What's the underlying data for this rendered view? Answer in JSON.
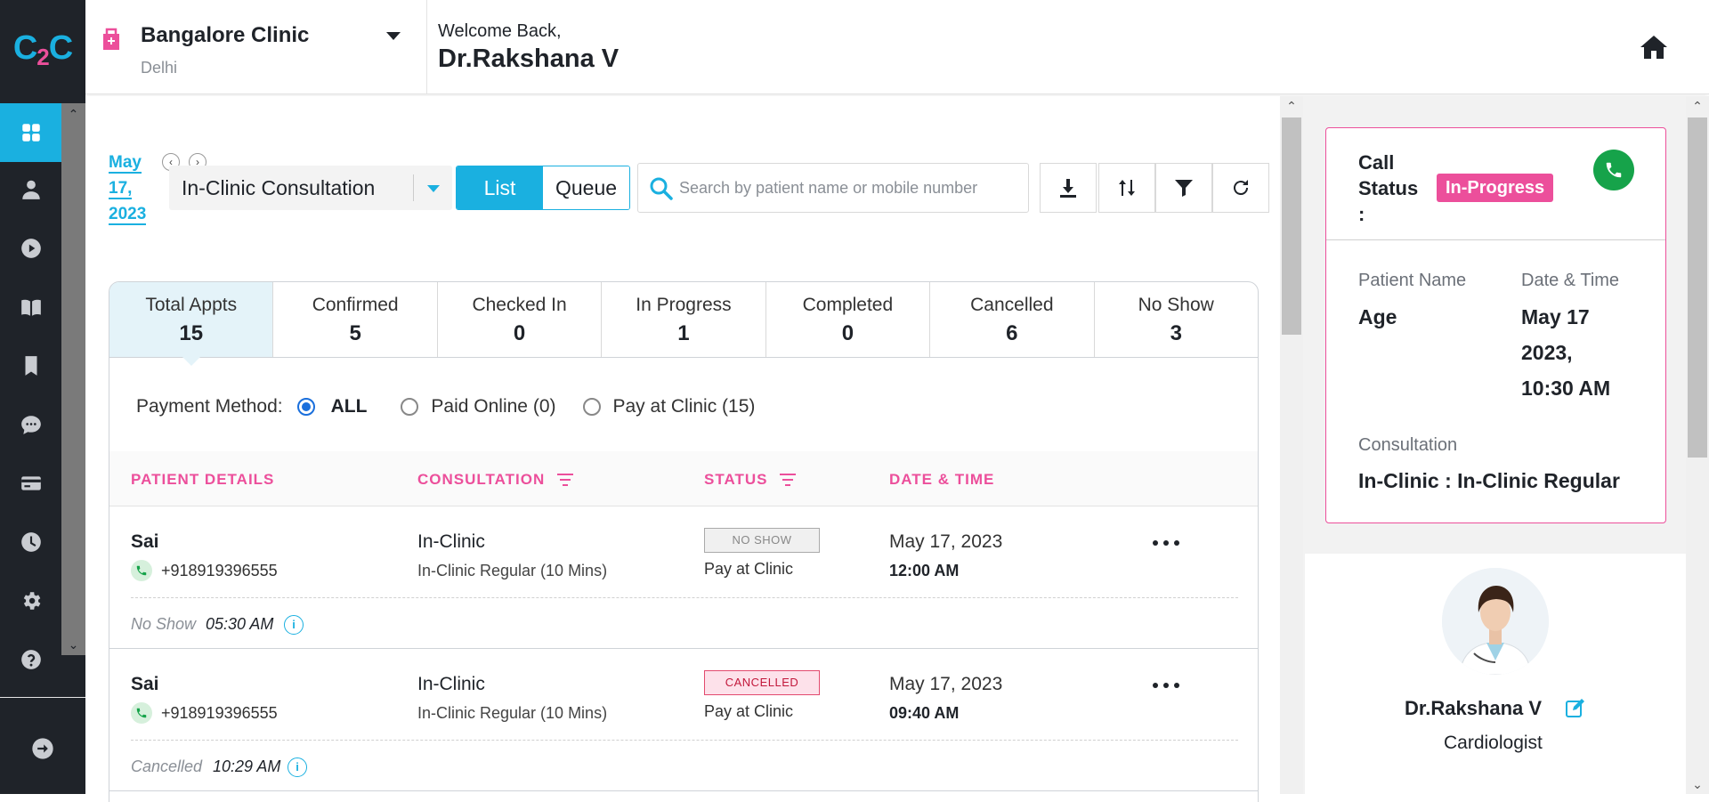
{
  "sidebar": {
    "logo": {
      "c1": "C",
      "two": "2",
      "c2": "C"
    },
    "items": [
      {
        "name": "dashboard-icon",
        "active": true
      },
      {
        "name": "user-icon"
      },
      {
        "name": "play-icon"
      },
      {
        "name": "book-icon"
      },
      {
        "name": "bookmark-icon"
      },
      {
        "name": "chat-icon"
      },
      {
        "name": "card-icon"
      },
      {
        "name": "clock-icon"
      },
      {
        "name": "gear-icon"
      },
      {
        "name": "help-icon"
      }
    ],
    "logout_icon": "logout-icon"
  },
  "header": {
    "clinic_name": "Bangalore Clinic",
    "clinic_city": "Delhi",
    "welcome": "Welcome Back,",
    "doctor_name": "Dr.Rakshana V"
  },
  "toolbar": {
    "date_line1": "May",
    "date_line2": "17,",
    "date_line3": "2023",
    "consultation_type": "In-Clinic Consultation",
    "view_list": "List",
    "view_queue": "Queue",
    "search_placeholder": "Search by patient name or mobile number"
  },
  "stats": [
    {
      "label": "Total Appts",
      "value": "15",
      "active": true
    },
    {
      "label": "Confirmed",
      "value": "5"
    },
    {
      "label": "Checked In",
      "value": "0"
    },
    {
      "label": "In Progress",
      "value": "1"
    },
    {
      "label": "Completed",
      "value": "0"
    },
    {
      "label": "Cancelled",
      "value": "6"
    },
    {
      "label": "No Show",
      "value": "3"
    }
  ],
  "payment": {
    "label": "Payment Method:",
    "options": [
      {
        "label": "ALL",
        "checked": true
      },
      {
        "label": "Paid Online (0)"
      },
      {
        "label": "Pay at Clinic (15)"
      }
    ]
  },
  "table": {
    "headers": {
      "patient": "PATIENT DETAILS",
      "consultation": "CONSULTATION",
      "status": "STATUS",
      "datetime": "DATE & TIME"
    },
    "rows": [
      {
        "name": "Sai",
        "phone": "+918919396555",
        "consult_type": "In-Clinic",
        "consult_desc": "In-Clinic Regular (10 Mins)",
        "status": "NO SHOW",
        "payment": "Pay at Clinic",
        "date": "May 17, 2023",
        "time": "12:00 AM",
        "note_label": "No Show",
        "note_time": "05:30 AM"
      },
      {
        "name": "Sai",
        "phone": "+918919396555",
        "consult_type": "In-Clinic",
        "consult_desc": "In-Clinic Regular (10 Mins)",
        "status": "CANCELLED",
        "payment": "Pay at Clinic",
        "date": "May 17, 2023",
        "time": "09:40 AM",
        "note_label": "Cancelled",
        "note_time": "10:29 AM"
      }
    ]
  },
  "call_panel": {
    "status_label_1": "Call",
    "status_label_2": "Status",
    "status_label_3": ":",
    "status_value": "In-Progress",
    "patient_name_label": "Patient Name",
    "age_label": "Age",
    "datetime_label": "Date & Time",
    "datetime_line1": "May 17",
    "datetime_line2": "2023,",
    "datetime_line3": "10:30 AM",
    "consultation_label": "Consultation",
    "consultation_value": "In-Clinic : In-Clinic Regular"
  },
  "doctor_profile": {
    "name": "Dr.Rakshana V",
    "specialty": "Cardiologist"
  },
  "colors": {
    "accent": "#1ab0e0",
    "pink": "#ec4f9b",
    "sidebar": "#1f2329",
    "call_green": "#16a34a"
  }
}
